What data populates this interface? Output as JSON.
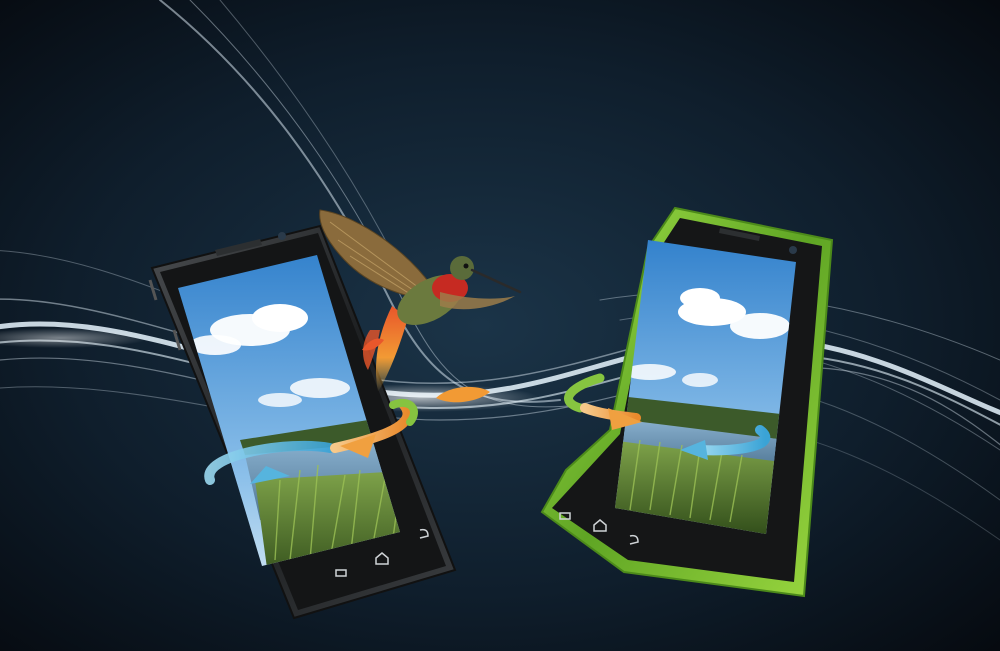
{
  "scene": {
    "description_free": true,
    "colors": {
      "background_center": "#1b3448",
      "background_edge": "#05080d",
      "light_streak": "#e8f6ff",
      "left_phone_frame": "#2b2e31",
      "right_phone_frame": "#7ecb2c",
      "arrow_blue": "#6fc6e8",
      "arrow_orange": "#f2a24a",
      "arrow_green": "#86c440",
      "sky": "#3d8fd6",
      "water": "#6d97b8",
      "grass": "#5f8b2c",
      "bird_body": "#5a6b3a",
      "bird_throat": "#d2332a"
    },
    "icons": [
      "back-icon",
      "home-icon",
      "menu-icon",
      "rotate-arrow-icon"
    ]
  }
}
